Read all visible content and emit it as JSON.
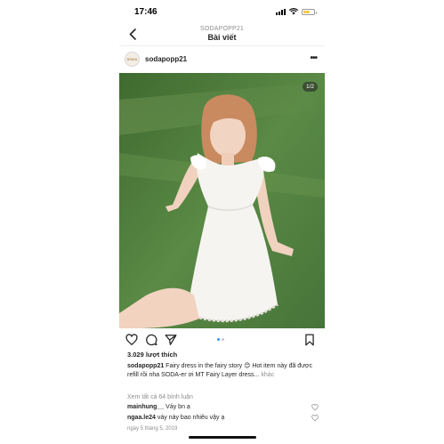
{
  "status_bar": {
    "time": "17:46"
  },
  "header": {
    "username_small": "SODAPOPP21",
    "title": "Bài viết"
  },
  "post": {
    "username": "sodapopp21",
    "avatar_text": "SODA",
    "image_counter": "1/2",
    "likes": "3.029 lượt thích",
    "caption_user": "sodapopp21",
    "caption_text": " Fairy dress in the fairy story 😊 Hot item này đã được refill rồi nha SODA-er ơi MT Fairy Layer dress...",
    "caption_more": " khác",
    "view_all_comments": "Xem tất cả 64 bình luận",
    "comments": [
      {
        "user": "mainhung__",
        "text": " Váy bn ạ"
      },
      {
        "user": "ngaa.le24",
        "text": " váy này bao nhiêu vậy ạ"
      }
    ],
    "date": "ngày 5 tháng 5, 2019"
  },
  "icons": {
    "back": "chevron-left-icon",
    "more": "more-dots-icon",
    "like": "heart-icon",
    "comment": "comment-icon",
    "share": "send-icon",
    "save": "bookmark-icon"
  },
  "colors": {
    "accent_dot": "#3897f0",
    "grass": "#4f7a3e",
    "muted_text": "#8e8e8e"
  }
}
